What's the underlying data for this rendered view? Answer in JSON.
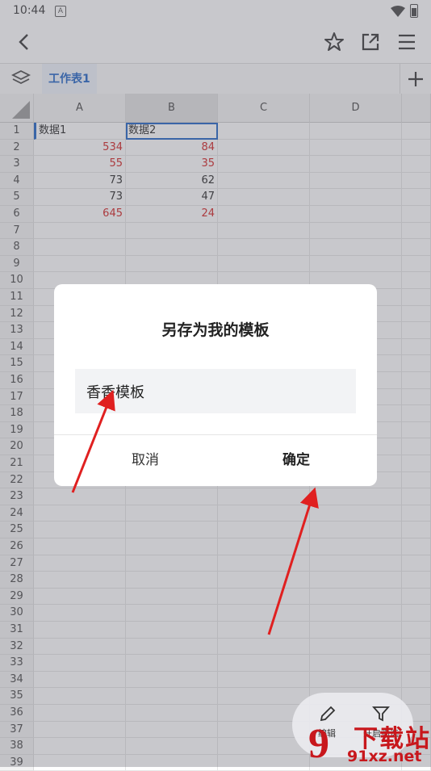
{
  "status": {
    "time": "10:44"
  },
  "sheet": {
    "tab": "工作表1",
    "columns": [
      "A",
      "B",
      "C",
      "D"
    ]
  },
  "rows": [
    {
      "num": "1",
      "a": "数据1",
      "b": "数据2"
    },
    {
      "num": "2",
      "a": "534",
      "b": "84"
    },
    {
      "num": "3",
      "a": "55",
      "b": "35"
    },
    {
      "num": "4",
      "a": "73",
      "b": "62"
    },
    {
      "num": "5",
      "a": "73",
      "b": "47"
    },
    {
      "num": "6",
      "a": "645",
      "b": "24"
    }
  ],
  "empty_rows": [
    "7",
    "8",
    "9",
    "10",
    "11",
    "12",
    "13",
    "14",
    "15",
    "16",
    "17",
    "18",
    "19",
    "20",
    "21",
    "22",
    "23",
    "24",
    "25",
    "26",
    "27",
    "28",
    "29",
    "30",
    "31",
    "32",
    "33",
    "34",
    "35",
    "36",
    "37",
    "38",
    "39"
  ],
  "dialog": {
    "title": "另存为我的模板",
    "input_value": "香香模板",
    "cancel": "取消",
    "ok": "确定"
  },
  "fab": {
    "edit": "编辑",
    "filter": "开启筛选"
  },
  "watermark": {
    "brand": "下载站",
    "domain": "91xz.net",
    "logo": "9"
  },
  "colors": {
    "accent": "#1a5fc4",
    "red_text": "#d11b1b",
    "arrow": "#e02020"
  }
}
